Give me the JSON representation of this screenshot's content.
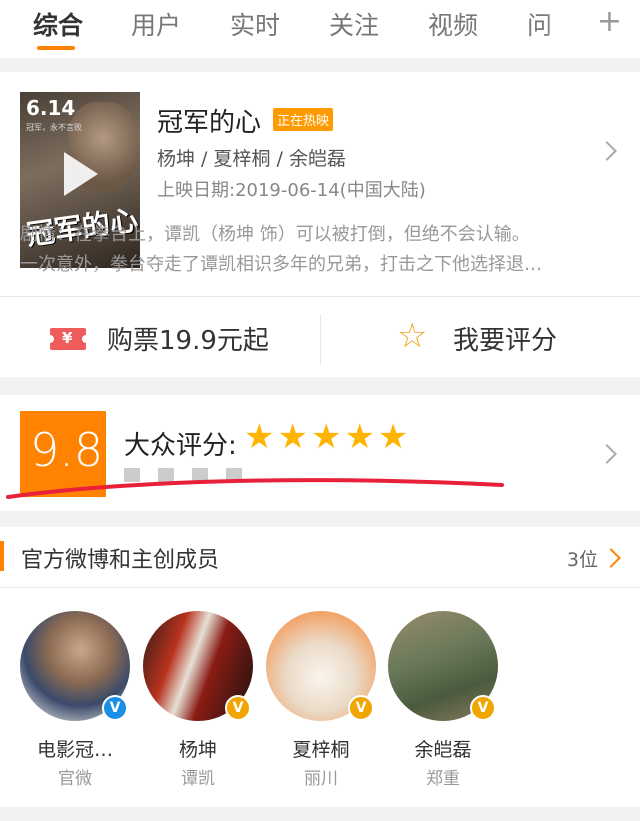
{
  "tabs": {
    "items": [
      "综合",
      "用户",
      "实时",
      "关注",
      "视频",
      "问"
    ],
    "active_index": 0,
    "add_icon": "plus-icon"
  },
  "movie": {
    "poster_date": "6.14",
    "poster_sub": "冠军，永不言败",
    "poster_title": "冠军的心",
    "title": "冠军的心",
    "badge": "正在热映",
    "cast": "杨坤 / 夏梓桐 / 余皑磊",
    "release": "上映日期:2019-06-14(中国大陆)",
    "plot_line1": "剧情：在拳台上，谭凯（杨坤 饰）可以被打倒，但绝不会认输。",
    "plot_line2": "一次意外，拳台夺走了谭凯相识多年的兄弟，打击之下他选择退…",
    "ticket_label": "购票19.9元起",
    "ticket_yen": "¥",
    "rate_label": "我要评分"
  },
  "score": {
    "value": "9.8",
    "label": "大众评分:",
    "stars": "★★★★★",
    "star_rating": 5
  },
  "members": {
    "section_title": "官方微博和主创成员",
    "count": "3位",
    "list": [
      {
        "name": "电影冠…",
        "role": "官微",
        "badge": "V",
        "badge_color": "#1a8fe6"
      },
      {
        "name": "杨坤",
        "role": "谭凯",
        "badge": "V",
        "badge_color": "#f0a500"
      },
      {
        "name": "夏梓桐",
        "role": "丽川",
        "badge": "V",
        "badge_color": "#f0a500"
      },
      {
        "name": "余皑磊",
        "role": "郑重",
        "badge": "V",
        "badge_color": "#f0a500"
      }
    ]
  },
  "colors": {
    "accent": "#ff8200",
    "star": "#ffb400",
    "ticket": "#f05c5c",
    "annotation_line": "#e8203a"
  }
}
